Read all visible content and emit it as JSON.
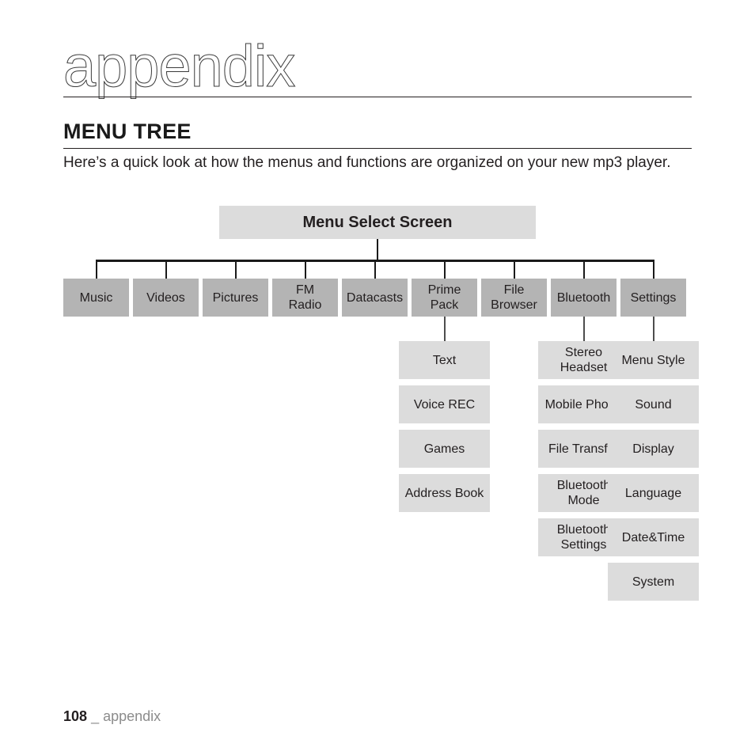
{
  "page": {
    "title": "appendix",
    "section_title": "MENU TREE",
    "intro": "Here’s a quick look at how the menus and functions are organized on your new mp3 player.",
    "footer_page_number": "108",
    "footer_separator": "_",
    "footer_label": "appendix"
  },
  "colors": {
    "root_box": "#dcdcdc",
    "menu_box": "#b4b4b4",
    "sub_box": "#dcdcdc",
    "text": "#231f20",
    "line": "#1a1a1a",
    "sub_line": "#4d4d4d",
    "footer_label": "#8c8c8c"
  },
  "diagram": {
    "root": {
      "label": "Menu Select Screen"
    },
    "menu_items": [
      {
        "label": "Music",
        "children": []
      },
      {
        "label": "Videos",
        "children": []
      },
      {
        "label": "Pictures",
        "children": []
      },
      {
        "label": "FM\nRadio",
        "children": []
      },
      {
        "label": "Datacasts",
        "children": []
      },
      {
        "label": "Prime\nPack",
        "children": [
          "Text",
          "Voice REC",
          "Games",
          "Address Book"
        ]
      },
      {
        "label": "File\nBrowser",
        "children": []
      },
      {
        "label": "Bluetooth",
        "children": [
          "Stereo\nHeadset",
          "Mobile Phone",
          "File Transfer",
          "Bluetooth\nMode",
          "Bluetooth\nSettings"
        ]
      },
      {
        "label": "Settings",
        "children": [
          "Menu Style",
          "Sound",
          "Display",
          "Language",
          "Date&Time",
          "System"
        ]
      }
    ]
  }
}
